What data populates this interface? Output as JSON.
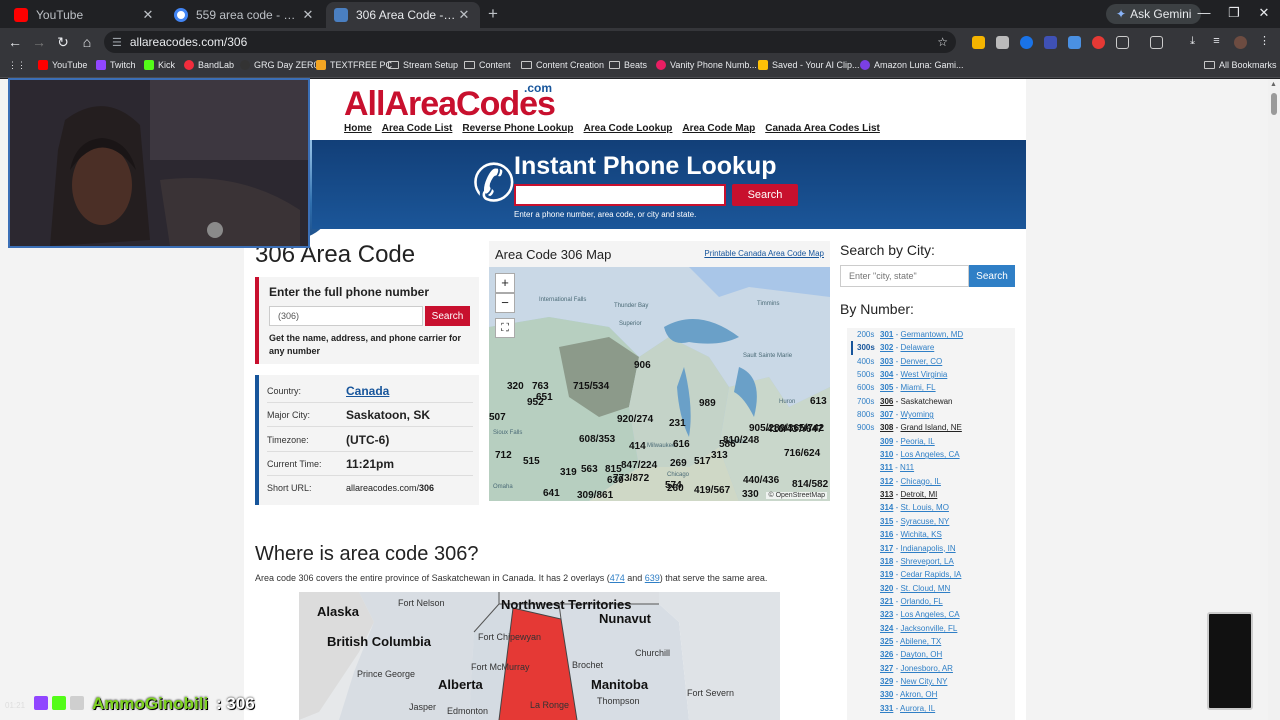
{
  "browser": {
    "tabs": [
      {
        "title": "YouTube",
        "favicon_color": "#ff0000"
      },
      {
        "title": "559 area code - Google Search",
        "favicon_color": "#4285f4"
      },
      {
        "title": "306 Area Code - Location map",
        "favicon_color": "#4a7fc1"
      }
    ],
    "gemini_label": "Ask Gemini",
    "url": "allareacodes.com/306",
    "bookmarks": [
      "YouTube",
      "Twitch",
      "Kick",
      "BandLab",
      "GRG Day ZER0",
      "TEXTFREE PC",
      "Stream Setup",
      "Content",
      "Content Creation",
      "Beats",
      "Vanity Phone Numb...",
      "Saved - Your AI Clip...",
      "Amazon Luna: Gami..."
    ],
    "all_bookmarks": "All Bookmarks"
  },
  "site": {
    "logo_main": "AllAreaCodes",
    "logo_com": ".com",
    "nav": [
      "Home",
      "Area Code List",
      "Reverse Phone Lookup",
      "Area Code Lookup",
      "Area Code Map",
      "Canada Area Codes List"
    ],
    "banner_title": "Instant Phone Lookup",
    "banner_search": "Search",
    "banner_hint": "Enter a phone number, area code, or city and state."
  },
  "main": {
    "title": "306 Area Code",
    "enter_title": "Enter the full phone number",
    "enter_value": "(306)",
    "enter_search": "Search",
    "enter_note": "Get the name, address, and phone carrier for any number",
    "info": {
      "country_key": "Country:",
      "country_val": "Canada",
      "city_key": "Major City:",
      "city_val": "Saskatoon, SK",
      "tz_key": "Timezone:",
      "tz_val": "(UTC-6)",
      "time_key": "Current Time:",
      "time_val": "11:21pm",
      "url_key": "Short URL:",
      "url_prefix": "allareacodes.com/",
      "url_code": "306"
    },
    "map_title": "Area Code 306 Map",
    "map_link": "Printable Canada Area Code Map",
    "map_zoom_in": "+",
    "map_zoom_out": "−",
    "map_attr": "© OpenStreetMap",
    "map_codes": [
      "906",
      "320",
      "763",
      "715/534",
      "952",
      "651",
      "989",
      "613",
      "507",
      "920/274",
      "231",
      "608/353",
      "414",
      "616",
      "810/248",
      "416/437/647",
      "712",
      "515",
      "319",
      "563",
      "815",
      "847/224",
      "269",
      "517",
      "313",
      "586",
      "905/289/365/742",
      "716/624",
      "630",
      "773/872",
      "574",
      "260",
      "419/567",
      "440/436",
      "330",
      "814/582",
      "641",
      "309/861"
    ],
    "map_places": [
      "International Falls",
      "Thunder Bay",
      "Superior",
      "Timmins",
      "Sault Sainte Marie",
      "Huron",
      "Sioux Falls",
      "Milwaukee",
      "Detroit",
      "Omaha",
      "Chicago"
    ],
    "where_title": "Where is area code 306?",
    "where_pre": "Area code 306 covers the entire province of Saskatchewan in Canada. It has 2 overlays (",
    "where_o1": "474",
    "where_and": " and ",
    "where_o2": "639",
    "where_post": ") that serve the same area.",
    "canada_map": {
      "provinces": [
        "Alaska",
        "British Columbia",
        "Alberta",
        "Northwest Territories",
        "Nunavut",
        "Manitoba"
      ],
      "cities": [
        "Fort Nelson",
        "Fort Chipewyan",
        "Fort McMurray",
        "Prince George",
        "Brochet",
        "Churchill",
        "Fort Severn",
        "Thompson",
        "La Ronge",
        "Jasper",
        "Edmonton"
      ]
    }
  },
  "sidebar": {
    "city_title": "Search by City:",
    "city_placeholder": "Enter \"city, state\"",
    "city_search": "Search",
    "number_title": "By Number:",
    "hundreds": [
      "200s",
      "300s",
      "400s",
      "500s",
      "600s",
      "700s",
      "800s",
      "900s"
    ],
    "codes": [
      {
        "num": "301",
        "name": "Germantown, MD"
      },
      {
        "num": "302",
        "name": "Delaware"
      },
      {
        "num": "303",
        "name": "Denver, CO"
      },
      {
        "num": "304",
        "name": "West Virginia"
      },
      {
        "num": "305",
        "name": "Miami, FL"
      },
      {
        "num": "306",
        "name": "Saskatchewan"
      },
      {
        "num": "307",
        "name": "Wyoming"
      },
      {
        "num": "308",
        "name": "Grand Island, NE"
      },
      {
        "num": "309",
        "name": "Peoria, IL"
      },
      {
        "num": "310",
        "name": "Los Angeles, CA"
      },
      {
        "num": "311",
        "name": "N11"
      },
      {
        "num": "312",
        "name": "Chicago, IL"
      },
      {
        "num": "313",
        "name": "Detroit, MI"
      },
      {
        "num": "314",
        "name": "St. Louis, MO"
      },
      {
        "num": "315",
        "name": "Syracuse, NY"
      },
      {
        "num": "316",
        "name": "Wichita, KS"
      },
      {
        "num": "317",
        "name": "Indianapolis, IN"
      },
      {
        "num": "318",
        "name": "Shreveport, LA"
      },
      {
        "num": "319",
        "name": "Cedar Rapids, IA"
      },
      {
        "num": "320",
        "name": "St. Cloud, MN"
      },
      {
        "num": "321",
        "name": "Orlando, FL"
      },
      {
        "num": "323",
        "name": "Los Angeles, CA"
      },
      {
        "num": "324",
        "name": "Jacksonville, FL"
      },
      {
        "num": "325",
        "name": "Abilene, TX"
      },
      {
        "num": "326",
        "name": "Dayton, OH"
      },
      {
        "num": "327",
        "name": "Jonesboro, AR"
      },
      {
        "num": "329",
        "name": "New City, NY"
      },
      {
        "num": "330",
        "name": "Akron, OH"
      },
      {
        "num": "331",
        "name": "Aurora, IL"
      }
    ]
  },
  "stream": {
    "name": "AmmoGinobili",
    "code": ": 306",
    "time": "01:21"
  },
  "colors": {
    "brand_red": "#c8102e",
    "brand_blue": "#17559b",
    "link_blue": "#2f7fc6",
    "saskatchewan": "#e53935"
  }
}
